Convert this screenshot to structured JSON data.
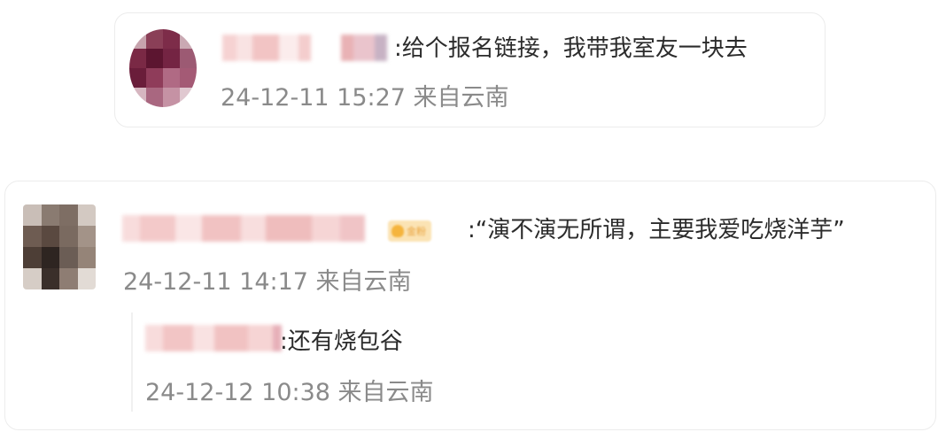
{
  "comments": [
    {
      "text": ":给个报名链接，我带我室友一块去",
      "meta": "24-12-11 15:27 来自云南"
    },
    {
      "badge_label": "金粉",
      "text": ":“演不演无所谓，主要我爱吃烧洋芋”",
      "meta": "24-12-11 14:17 来自云南",
      "reply": {
        "text": ":还有烧包谷",
        "meta": "24-12-12 10:38 来自云南"
      }
    }
  ],
  "colors": {
    "text": "#2b2b2b",
    "meta": "#8a8a8a",
    "card_border": "#ececec",
    "badge_bg": "#fbe3b4",
    "badge_fg": "#e9a13a"
  }
}
